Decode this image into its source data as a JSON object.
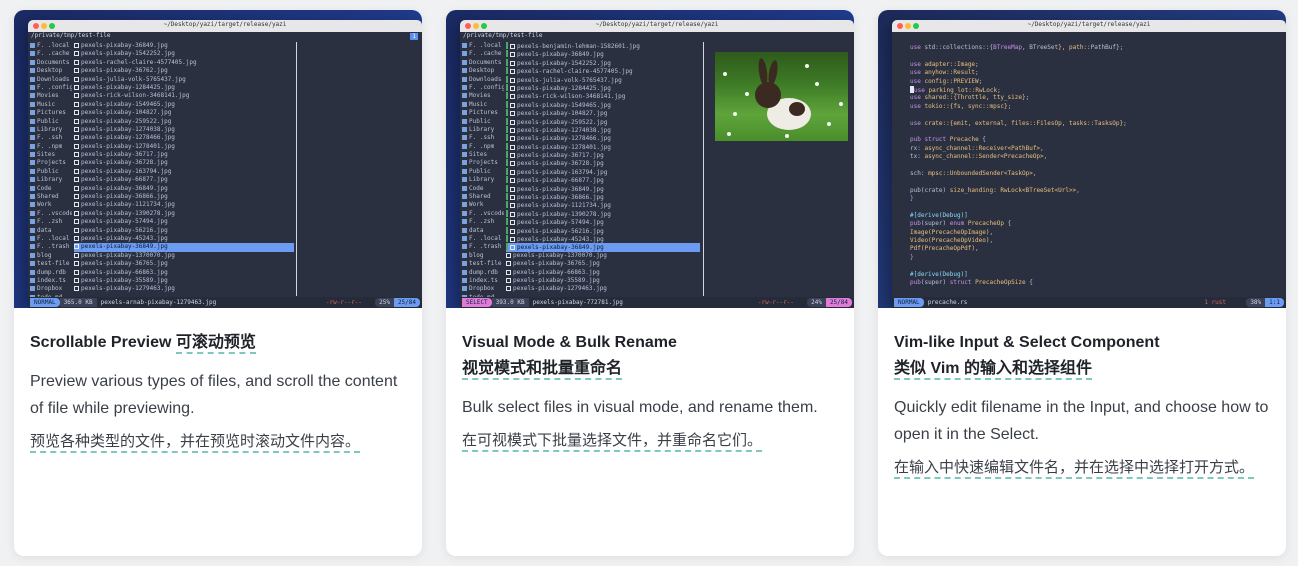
{
  "cards": [
    {
      "terminal": {
        "window_title": "~/Desktop/yazi/target/release/yazi",
        "path": "/private/tmp/test-file",
        "tab_number": "1",
        "parent_items": [
          "F. .local",
          "F. .cache",
          "Documents",
          "Desktop",
          "Downloads",
          "F. .config",
          "Movies",
          "Music",
          "Pictures",
          "Public",
          "Library",
          "F. .ssh",
          "F. .npm",
          "Sites",
          "Projects",
          "Public",
          "Library",
          "Code",
          "Shared",
          "Work",
          "F. .vscode",
          "F. .zsh",
          "data",
          "F. .local",
          "F. .trash",
          "blog",
          "test-file",
          "dump.rdb",
          "index.ts",
          "Dropbox",
          "todo.md",
          "yazi.toml",
          "Desktop"
        ],
        "files": [
          "pexels-pixabay-36849.jpg",
          "pexels-pixabay-1542252.jpg",
          "pexels-rachel-claire-4577405.jpg",
          "pexels-pixabay-36762.jpg",
          "pexels-julia-volk-5765437.jpg",
          "pexels-pixabay-1284425.jpg",
          "pexels-rick-wilson-3468141.jpg",
          "pexels-pixabay-1549465.jpg",
          "pexels-pixabay-104827.jpg",
          "pexels-pixabay-259522.jpg",
          "pexels-pixabay-1274038.jpg",
          "pexels-pixabay-1278466.jpg",
          "pexels-pixabay-1278401.jpg",
          "pexels-pixabay-36717.jpg",
          "pexels-pixabay-36728.jpg",
          "pexels-pixabay-163794.jpg",
          "pexels-pixabay-66877.jpg",
          "pexels-pixabay-36849.jpg",
          "pexels-pixabay-36866.jpg",
          "pexels-pixabay-1121734.jpg",
          "pexels-pixabay-1390278.jpg",
          "pexels-pixabay-57494.jpg",
          "pexels-pixabay-56216.jpg",
          "pexels-pixabay-45243.jpg",
          "pexels-pixabay-36849.jpg",
          "pexels-pixabay-1370070.jpg",
          "pexels-pixabay-36765.jpg",
          "pexels-pixabay-66863.jpg",
          "pexels-pixabay-35589.jpg",
          "pexels-pixabay-1279463.jpg"
        ],
        "highlight_index": 24,
        "mode": "NORMAL",
        "size": "365.0 KB",
        "status_file": "pexels-arnab-pixabay-1279463.jpg",
        "permissions": "-rw-r--r--",
        "position_a": "25%",
        "position_b": "25/84"
      },
      "title_en": "Scrollable Preview",
      "title_zh": "可滚动预览",
      "desc_en": "Preview various types of files, and scroll the content of file while previewing.",
      "desc_zh": "预览各种类型的文件，并在预览时滚动文件内容。"
    },
    {
      "terminal": {
        "window_title": "~/Desktop/yazi/target/release/yazi",
        "path": "/private/tmp/test-file",
        "parent_items": [
          "F. .local",
          "F. .cache",
          "Documents",
          "Desktop",
          "Downloads",
          "F. .config",
          "Movies",
          "Music",
          "Pictures",
          "Public",
          "Library",
          "F. .ssh",
          "F. .npm",
          "Sites",
          "Projects",
          "Public",
          "Library",
          "Code",
          "Shared",
          "Work",
          "F. .vscode",
          "F. .zsh",
          "data",
          "F. .local",
          "F. .trash",
          "blog",
          "test-file",
          "dump.rdb",
          "index.ts",
          "Dropbox",
          "todo.md",
          "yazi.toml",
          "Desktop"
        ],
        "files": [
          "pexels-benjamin-lehman-1582601.jpg",
          "pexels-pixabay-36849.jpg",
          "pexels-pixabay-1542252.jpg",
          "pexels-rachel-claire-4577405.jpg",
          "pexels-julia-volk-5765437.jpg",
          "pexels-pixabay-1284425.jpg",
          "pexels-rick-wilson-3468141.jpg",
          "pexels-pixabay-1549465.jpg",
          "pexels-pixabay-104827.jpg",
          "pexels-pixabay-259522.jpg",
          "pexels-pixabay-1274038.jpg",
          "pexels-pixabay-1278466.jpg",
          "pexels-pixabay-1278401.jpg",
          "pexels-pixabay-36717.jpg",
          "pexels-pixabay-36728.jpg",
          "pexels-pixabay-163794.jpg",
          "pexels-pixabay-66877.jpg",
          "pexels-pixabay-36849.jpg",
          "pexels-pixabay-36866.jpg",
          "pexels-pixabay-1121734.jpg",
          "pexels-pixabay-1390278.jpg",
          "pexels-pixabay-57494.jpg",
          "pexels-pixabay-56216.jpg",
          "pexels-pixabay-45243.jpg",
          "pexels-pixabay-36849.jpg",
          "pexels-pixabay-1370070.jpg",
          "pexels-pixabay-36765.jpg",
          "pexels-pixabay-66863.jpg",
          "pexels-pixabay-35589.jpg",
          "pexels-pixabay-1279463.jpg"
        ],
        "highlight_index": 24,
        "selected_from": 0,
        "selected_to": 24,
        "mode": "SELECT",
        "size": "393.0 KB",
        "status_file": "pexels-pixabay-772781.jpg",
        "permissions": "-rw-r--r--",
        "position_a": "24%",
        "position_b": "25/84"
      },
      "title_en": "Visual Mode & Bulk Rename",
      "title_zh": "视觉模式和批量重命名",
      "desc_en": "Bulk select files in visual mode, and rename them.",
      "desc_zh": "在可视模式下批量选择文件，并重命名它们。"
    },
    {
      "terminal": {
        "window_title": "~/Desktop/yazi/target/release/yazi",
        "code_lines": [
          [
            "use",
            " std::collections::{",
            "BTreeMap",
            ", ",
            "BTreeSet",
            "}, path::",
            "PathBuf",
            "};"
          ],
          [
            "",
            "",
            "",
            "",
            "",
            "",
            "",
            ""
          ],
          [
            "use",
            " ",
            "",
            "",
            "",
            "adapter::Image",
            "",
            ";"
          ],
          [
            "use",
            " ",
            "",
            "",
            "",
            "anyhow::Result",
            "",
            ";"
          ],
          [
            "use",
            " ",
            "",
            "",
            "",
            "config::PREVIEW",
            "",
            ";"
          ],
          [
            "use",
            " ",
            "",
            "",
            "",
            "parking_lot::RwLock",
            "",
            ";"
          ],
          [
            "use",
            " ",
            "",
            "",
            "",
            "shared::{Throttle, tty_size}",
            "",
            ";"
          ],
          [
            "use",
            " ",
            "",
            "",
            "",
            "tokio::{fs, sync::mpsc}",
            "",
            ";"
          ],
          [
            "",
            "",
            "",
            "",
            "",
            "",
            "",
            ""
          ],
          [
            "use",
            " ",
            "",
            "",
            "",
            "crate::{emit, external, files::FilesOp, tasks::TasksOp}",
            "",
            ";"
          ],
          [
            "",
            "",
            "",
            "",
            "",
            "",
            "",
            ""
          ],
          [
            "pub",
            " ",
            "struct",
            " ",
            "",
            "Precache",
            "",
            " {"
          ],
          [
            "",
            "    rx: ",
            "",
            "",
            "",
            "async_channel::Receiver<PathBuf>",
            "",
            ","
          ],
          [
            "",
            "    tx: ",
            "",
            "",
            "",
            "async_channel::Sender<PrecacheOp>",
            "",
            ","
          ],
          [
            "",
            "",
            "",
            "",
            "",
            "",
            "",
            ""
          ],
          [
            "",
            "    sch: ",
            "",
            "",
            "",
            "mpsc::UnboundedSender<TaskOp>",
            "",
            ","
          ],
          [
            "",
            "",
            "",
            "",
            "",
            "",
            "",
            ""
          ],
          [
            "",
            "    pub(crate) ",
            "",
            "",
            "",
            "size_handing: RwLock<BTreeSet<Url>>",
            "",
            ","
          ],
          [
            "}",
            "",
            "",
            "",
            "",
            "",
            "",
            ""
          ],
          [
            "",
            "",
            "",
            "",
            "",
            "",
            "",
            ""
          ],
          [
            "#[derive(Debug)]",
            "",
            "",
            "",
            "",
            "",
            "",
            ""
          ],
          [
            "pub",
            "(super) ",
            "enum",
            " ",
            "",
            "PrecacheOp",
            "",
            " {"
          ],
          [
            "",
            "    ",
            "",
            "",
            "",
            "Image(PrecacheOpImage)",
            "",
            ","
          ],
          [
            "",
            "    ",
            "",
            "",
            "",
            "Video(PrecacheOpVideo)",
            "",
            ","
          ],
          [
            "",
            "    ",
            "",
            "",
            "",
            "Pdf(PrecacheOpPdf)",
            "",
            ","
          ],
          [
            "}",
            "",
            "",
            "",
            "",
            "",
            "",
            ""
          ],
          [
            "",
            "",
            "",
            "",
            "",
            "",
            "",
            ""
          ],
          [
            "#[derive(Debug)]",
            "",
            "",
            "",
            "",
            "",
            "",
            ""
          ],
          [
            "pub",
            "(super) ",
            "struct",
            " ",
            "",
            "PrecacheOpSize",
            "",
            " {"
          ]
        ],
        "mode": "NORMAL",
        "status_file": "precache.rs",
        "modified": "1 rust",
        "position_a": "38%",
        "position_b": "1:1"
      },
      "title_en": "Vim-like Input & Select Component",
      "title_zh": "类似 Vim 的输入和选择组件",
      "desc_en": "Quickly edit filename in the Input, and choose how to open it in the Select.",
      "desc_zh": "在输入中快速编辑文件名，并在选择中选择打开方式。"
    }
  ]
}
